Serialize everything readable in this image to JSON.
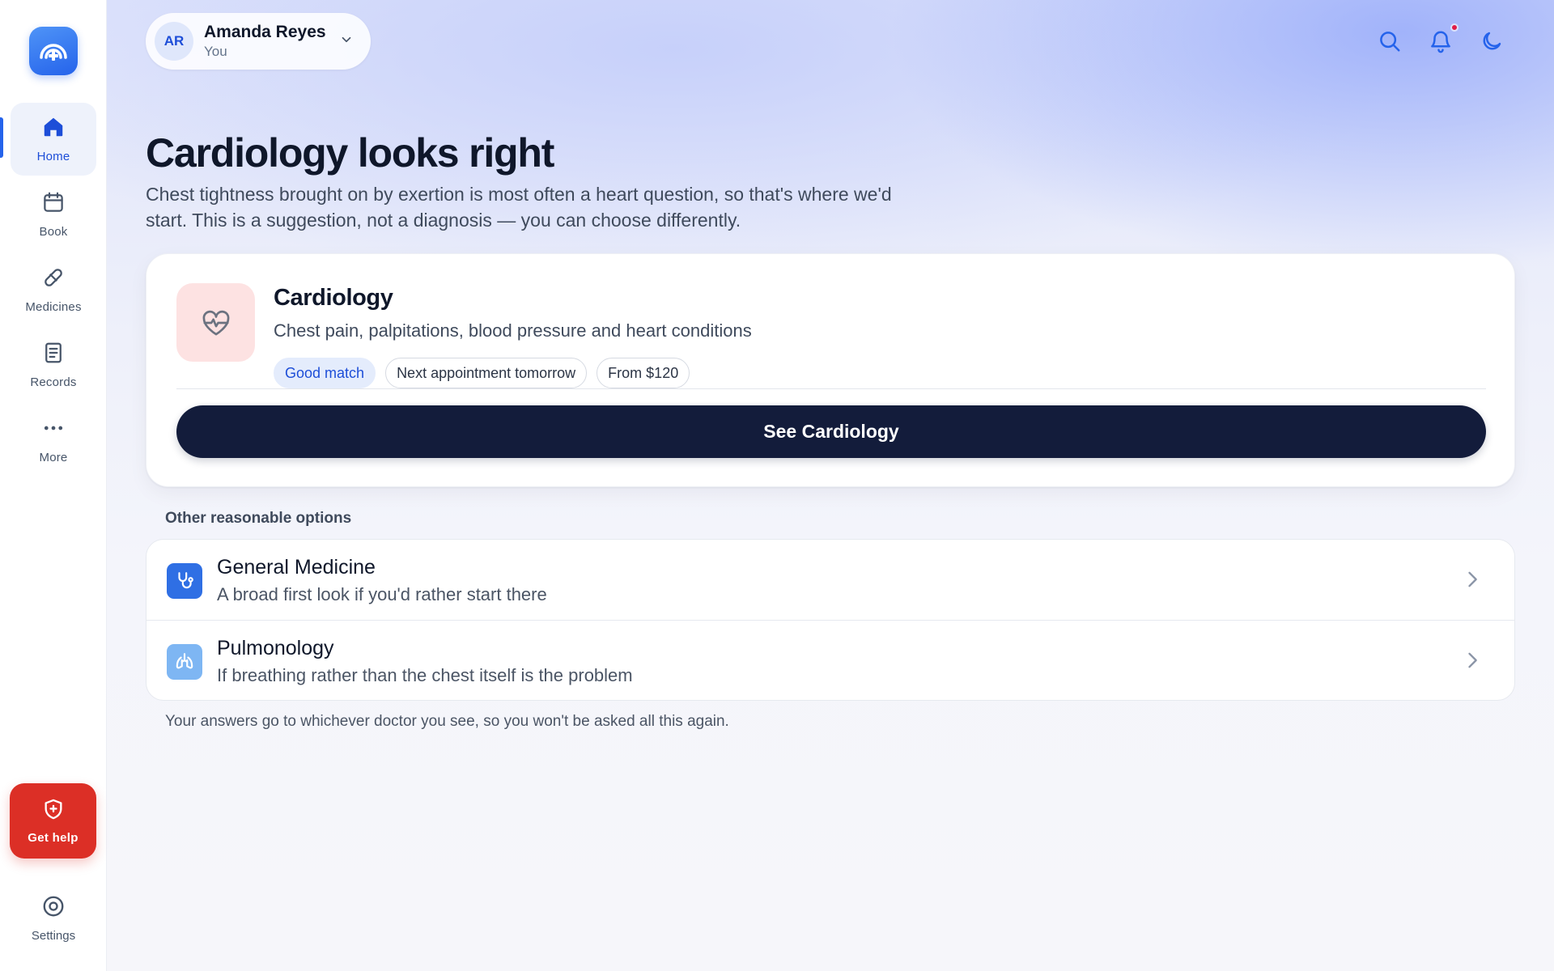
{
  "header": {
    "profile": {
      "initials": "AR",
      "name": "Amanda Reyes",
      "subtitle": "You"
    }
  },
  "sidebar": {
    "items": [
      {
        "label": "Home",
        "icon": "home-icon",
        "active": true
      },
      {
        "label": "Book",
        "icon": "calendar-icon",
        "active": false
      },
      {
        "label": "Medicines",
        "icon": "pill-icon",
        "active": false
      },
      {
        "label": "Records",
        "icon": "document-icon",
        "active": false
      },
      {
        "label": "More",
        "icon": "more-icon",
        "active": false
      }
    ],
    "help_label": "Get help",
    "settings_label": "Settings"
  },
  "hero": {
    "title": "Cardiology looks right",
    "description": "Chest tightness brought on by exertion is most often a heart question, so that's where we'd start. This is a suggestion, not a diagnosis — you can choose differently."
  },
  "recommendation": {
    "title": "Cardiology",
    "description": "Chest pain, palpitations, blood pressure and heart conditions",
    "tags": [
      "Good match",
      "Next appointment tomorrow",
      "From $120"
    ],
    "button_label": "See Cardiology",
    "icon": "heart-pulse-icon"
  },
  "other_options": {
    "label": "Other reasonable options",
    "items": [
      {
        "title": "General Medicine",
        "description": "A broad first look if you'd rather start there",
        "icon": "stethoscope-icon"
      },
      {
        "title": "Pulmonology",
        "description": "If breathing rather than the chest itself is the problem",
        "icon": "lungs-icon"
      }
    ]
  },
  "footnote": "Your answers go to whichever doctor you see, so you won't be asked all this again.",
  "colors": {
    "accent": "#2563eb",
    "primary_button": "#131c3b",
    "help_button": "#dc2f26",
    "notification_dot": "#e11d48"
  }
}
